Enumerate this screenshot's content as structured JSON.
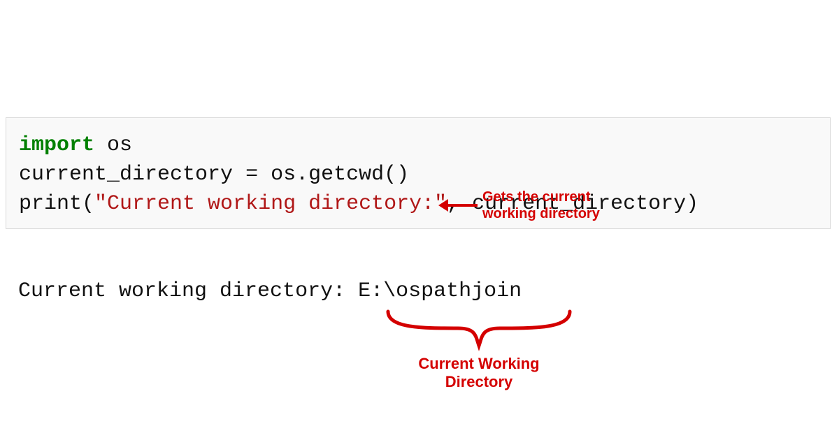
{
  "code": {
    "line1": {
      "kw": "import",
      "rest": " os"
    },
    "blank": "",
    "line3_pre": "current_directory ",
    "line3_eq": "=",
    "line3_call": " os.getcwd()",
    "line4_func": "print",
    "line4_open": "(",
    "line4_str": "\"Current working directory:\"",
    "line4_rest": ", current_directory)"
  },
  "output": {
    "label": "Current working directory: ",
    "path": "E:\\ospathjoin"
  },
  "annotations": {
    "arrow_text": "Gets the current\nworking directory",
    "brace_text": "Current Working\nDirectory"
  },
  "colors": {
    "annotation": "#d40000",
    "keyword": "#008000",
    "string": "#b01717"
  }
}
